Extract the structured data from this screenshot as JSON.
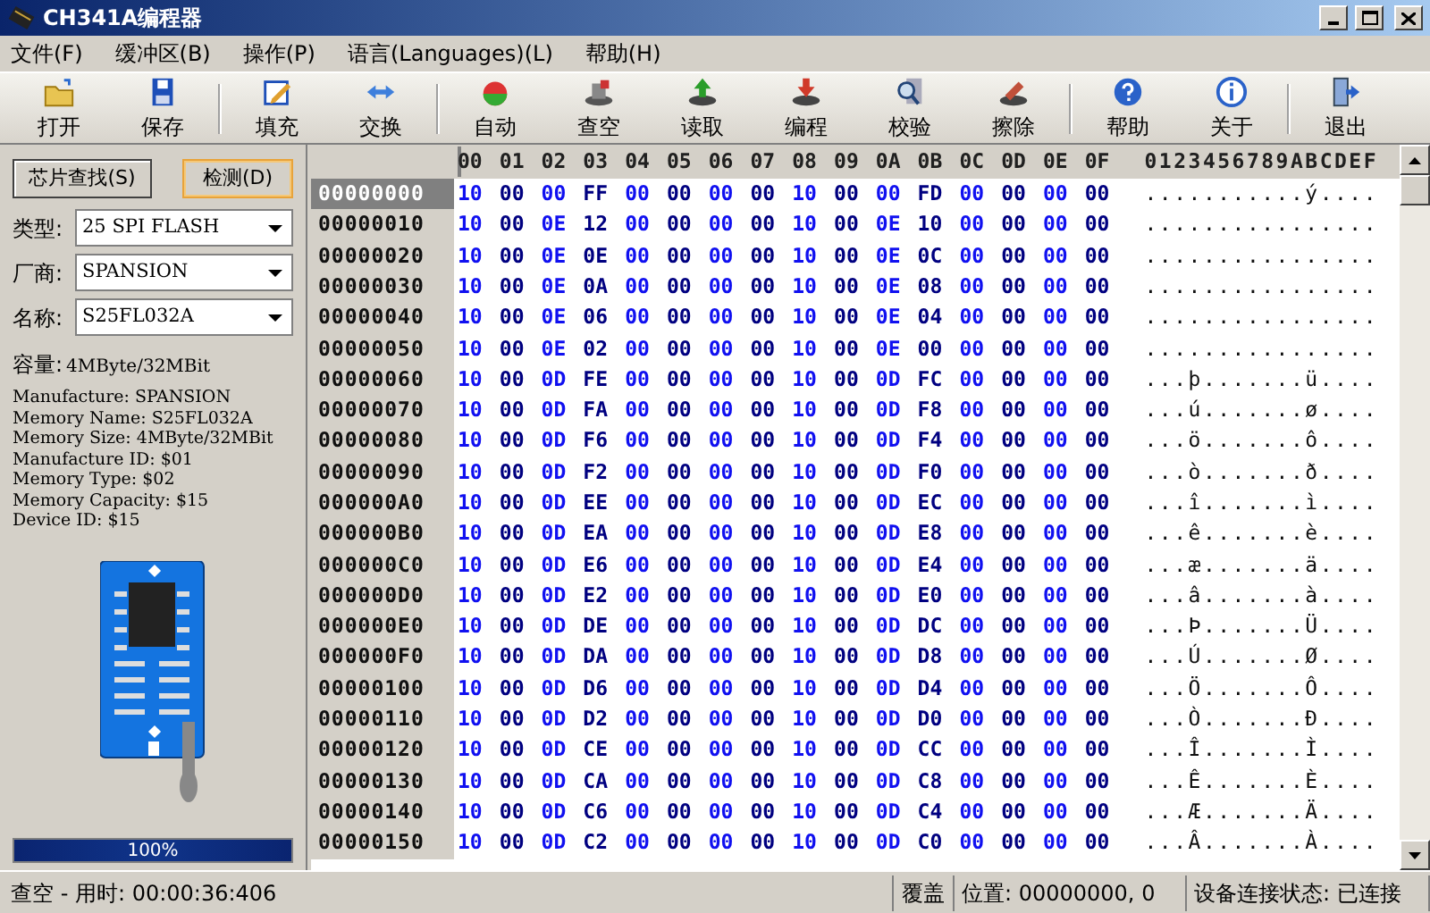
{
  "window": {
    "title": "CH341A编程器"
  },
  "menu": [
    "文件(F)",
    "缓冲区(B)",
    "操作(P)",
    "语言(Languages)(L)",
    "帮助(H)"
  ],
  "toolbar": [
    {
      "kind": "button",
      "label": "打开"
    },
    {
      "kind": "button",
      "label": "保存"
    },
    {
      "kind": "separator"
    },
    {
      "kind": "button",
      "label": "填充"
    },
    {
      "kind": "button",
      "label": "交换"
    },
    {
      "kind": "separator"
    },
    {
      "kind": "button",
      "label": "自动"
    },
    {
      "kind": "button",
      "label": "查空"
    },
    {
      "kind": "button",
      "label": "读取"
    },
    {
      "kind": "button",
      "label": "编程"
    },
    {
      "kind": "button",
      "label": "校验"
    },
    {
      "kind": "button",
      "label": "擦除"
    },
    {
      "kind": "separator"
    },
    {
      "kind": "button",
      "label": "帮助"
    },
    {
      "kind": "button",
      "label": "关于"
    },
    {
      "kind": "separator"
    },
    {
      "kind": "button",
      "label": "退出"
    }
  ],
  "chip_panel": {
    "buttons": [
      {
        "label": "芯片查找(S)",
        "focused": false
      },
      {
        "label": "检测(D)",
        "focused": true
      }
    ],
    "fields": [
      {
        "label": "类型:",
        "value": "25 SPI FLASH"
      },
      {
        "label": "厂商:",
        "value": "SPANSION"
      },
      {
        "label": "名称:",
        "value": "S25FL032A"
      }
    ],
    "capacity": {
      "label": "容量:",
      "value": "4MByte/32MBit"
    },
    "info": [
      "Manufacture: SPANSION",
      "Memory Name: S25FL032A",
      "Memory Size: 4MByte/32MBit",
      "Manufacture ID: $01",
      "Memory Type: $02",
      "Memory Capacity: $15",
      "Device ID: $15"
    ],
    "progress": {
      "level": 1,
      "text": "100%"
    }
  },
  "hex": {
    "columns": [
      "00",
      "01",
      "02",
      "03",
      "04",
      "05",
      "06",
      "07",
      "08",
      "09",
      "0A",
      "0B",
      "0C",
      "0D",
      "0E",
      "0F"
    ],
    "ascii_header": "0123456789ABCDEF",
    "rows": [
      {
        "address": "00000000",
        "selected": true,
        "bytes": "10 00 00 FF 00 00 00 00 10 00 00 FD 00 00 00 00",
        "ascii": "...........ý...."
      },
      {
        "address": "00000010",
        "selected": false,
        "bytes": "10 00 0E 12 00 00 00 00 10 00 0E 10 00 00 00 00",
        "ascii": "................"
      },
      {
        "address": "00000020",
        "selected": false,
        "bytes": "10 00 0E 0E 00 00 00 00 10 00 0E 0C 00 00 00 00",
        "ascii": "................"
      },
      {
        "address": "00000030",
        "selected": false,
        "bytes": "10 00 0E 0A 00 00 00 00 10 00 0E 08 00 00 00 00",
        "ascii": "................"
      },
      {
        "address": "00000040",
        "selected": false,
        "bytes": "10 00 0E 06 00 00 00 00 10 00 0E 04 00 00 00 00",
        "ascii": "................"
      },
      {
        "address": "00000050",
        "selected": false,
        "bytes": "10 00 0E 02 00 00 00 00 10 00 0E 00 00 00 00 00",
        "ascii": "................"
      },
      {
        "address": "00000060",
        "selected": false,
        "bytes": "10 00 0D FE 00 00 00 00 10 00 0D FC 00 00 00 00",
        "ascii": "...þ.......ü...."
      },
      {
        "address": "00000070",
        "selected": false,
        "bytes": "10 00 0D FA 00 00 00 00 10 00 0D F8 00 00 00 00",
        "ascii": "...ú.......ø...."
      },
      {
        "address": "00000080",
        "selected": false,
        "bytes": "10 00 0D F6 00 00 00 00 10 00 0D F4 00 00 00 00",
        "ascii": "...ö.......ô...."
      },
      {
        "address": "00000090",
        "selected": false,
        "bytes": "10 00 0D F2 00 00 00 00 10 00 0D F0 00 00 00 00",
        "ascii": "...ò.......ð...."
      },
      {
        "address": "000000A0",
        "selected": false,
        "bytes": "10 00 0D EE 00 00 00 00 10 00 0D EC 00 00 00 00",
        "ascii": "...î.......ì...."
      },
      {
        "address": "000000B0",
        "selected": false,
        "bytes": "10 00 0D EA 00 00 00 00 10 00 0D E8 00 00 00 00",
        "ascii": "...ê.......è...."
      },
      {
        "address": "000000C0",
        "selected": false,
        "bytes": "10 00 0D E6 00 00 00 00 10 00 0D E4 00 00 00 00",
        "ascii": "...æ.......ä...."
      },
      {
        "address": "000000D0",
        "selected": false,
        "bytes": "10 00 0D E2 00 00 00 00 10 00 0D E0 00 00 00 00",
        "ascii": "...â.......à...."
      },
      {
        "address": "000000E0",
        "selected": false,
        "bytes": "10 00 0D DE 00 00 00 00 10 00 0D DC 00 00 00 00",
        "ascii": "...Þ.......Ü...."
      },
      {
        "address": "000000F0",
        "selected": false,
        "bytes": "10 00 0D DA 00 00 00 00 10 00 0D D8 00 00 00 00",
        "ascii": "...Ú.......Ø...."
      },
      {
        "address": "00000100",
        "selected": false,
        "bytes": "10 00 0D D6 00 00 00 00 10 00 0D D4 00 00 00 00",
        "ascii": "...Ö.......Ô...."
      },
      {
        "address": "00000110",
        "selected": false,
        "bytes": "10 00 0D D2 00 00 00 00 10 00 0D D0 00 00 00 00",
        "ascii": "...Ò.......Ð...."
      },
      {
        "address": "00000120",
        "selected": false,
        "bytes": "10 00 0D CE 00 00 00 00 10 00 0D CC 00 00 00 00",
        "ascii": "...Î.......Ì...."
      },
      {
        "address": "00000130",
        "selected": false,
        "bytes": "10 00 0D CA 00 00 00 00 10 00 0D C8 00 00 00 00",
        "ascii": "...Ê.......È...."
      },
      {
        "address": "00000140",
        "selected": false,
        "bytes": "10 00 0D C6 00 00 00 00 10 00 0D C4 00 00 00 00",
        "ascii": "...Æ.......Ä...."
      },
      {
        "address": "00000150",
        "selected": false,
        "bytes": "10 00 0D C2 00 00 00 00 10 00 0D C0 00 00 00 00",
        "ascii": "...Â.......À...."
      }
    ]
  },
  "status_bar": [
    "查空 - 用时: 00:00:36:406",
    "覆盖",
    "位置: 00000000, 0",
    "设备连接状态: 已连接"
  ]
}
